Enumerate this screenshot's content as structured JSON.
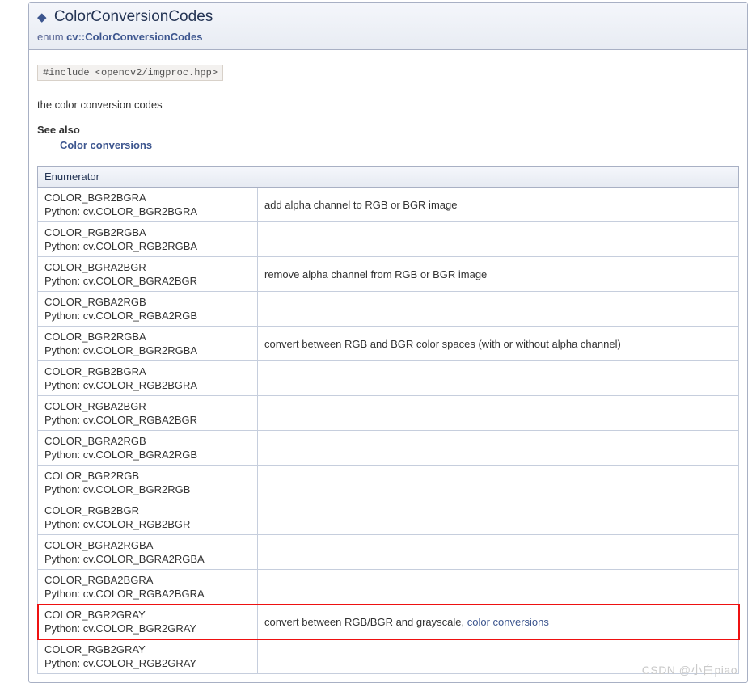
{
  "header": {
    "anchor_glyph": "◆",
    "title": "ColorConversionCodes",
    "sub_keyword": "enum ",
    "sub_link": "cv::ColorConversionCodes"
  },
  "include_line": "#include <opencv2/imgproc.hpp>",
  "intro": "the color conversion codes",
  "see_also_label": "See also",
  "see_also_link": "Color conversions",
  "table_header": "Enumerator",
  "python_prefix": "Python: ",
  "rows": [
    {
      "name": "COLOR_BGR2BGRA",
      "py": "cv.COLOR_BGR2BGRA",
      "desc": "add alpha channel to RGB or BGR image",
      "link": ""
    },
    {
      "name": "COLOR_RGB2RGBA",
      "py": "cv.COLOR_RGB2RGBA",
      "desc": "",
      "link": ""
    },
    {
      "name": "COLOR_BGRA2BGR",
      "py": "cv.COLOR_BGRA2BGR",
      "desc": "remove alpha channel from RGB or BGR image",
      "link": ""
    },
    {
      "name": "COLOR_RGBA2RGB",
      "py": "cv.COLOR_RGBA2RGB",
      "desc": "",
      "link": ""
    },
    {
      "name": "COLOR_BGR2RGBA",
      "py": "cv.COLOR_BGR2RGBA",
      "desc": "convert between RGB and BGR color spaces (with or without alpha channel)",
      "link": ""
    },
    {
      "name": "COLOR_RGB2BGRA",
      "py": "cv.COLOR_RGB2BGRA",
      "desc": "",
      "link": ""
    },
    {
      "name": "COLOR_RGBA2BGR",
      "py": "cv.COLOR_RGBA2BGR",
      "desc": "",
      "link": ""
    },
    {
      "name": "COLOR_BGRA2RGB",
      "py": "cv.COLOR_BGRA2RGB",
      "desc": "",
      "link": ""
    },
    {
      "name": "COLOR_BGR2RGB",
      "py": "cv.COLOR_BGR2RGB",
      "desc": "",
      "link": ""
    },
    {
      "name": "COLOR_RGB2BGR",
      "py": "cv.COLOR_RGB2BGR",
      "desc": "",
      "link": ""
    },
    {
      "name": "COLOR_BGRA2RGBA",
      "py": "cv.COLOR_BGRA2RGBA",
      "desc": "",
      "link": ""
    },
    {
      "name": "COLOR_RGBA2BGRA",
      "py": "cv.COLOR_RGBA2BGRA",
      "desc": "",
      "link": ""
    },
    {
      "name": "COLOR_BGR2GRAY",
      "py": "cv.COLOR_BGR2GRAY",
      "desc": "convert between RGB/BGR and grayscale, ",
      "link": "color conversions",
      "highlight": true
    },
    {
      "name": "COLOR_RGB2GRAY",
      "py": "cv.COLOR_RGB2GRAY",
      "desc": "",
      "link": ""
    }
  ],
  "watermark": "CSDN @小白piao"
}
